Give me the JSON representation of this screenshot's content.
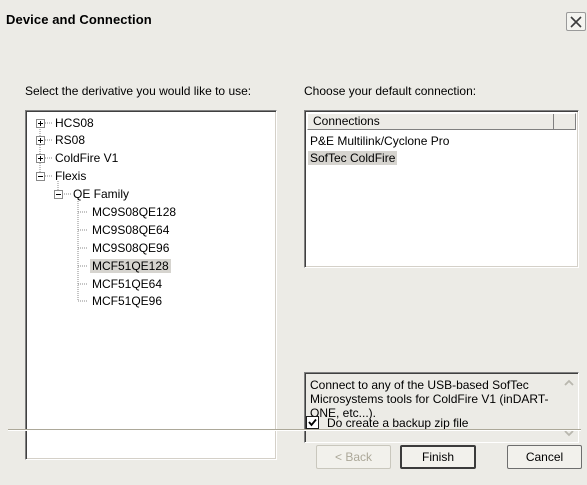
{
  "window": {
    "title": "Device and Connection"
  },
  "left_prompt": "Select the derivative you would like to use:",
  "right_prompt": "Choose your default connection:",
  "tree": {
    "items": [
      {
        "label": "HCS08",
        "expander": "+"
      },
      {
        "label": "RS08",
        "expander": "+"
      },
      {
        "label": "ColdFire V1",
        "expander": "+"
      },
      {
        "label": "Flexis",
        "expander": "-"
      },
      {
        "label": "QE Family",
        "expander": "-"
      },
      {
        "label": "MC9S08QE128"
      },
      {
        "label": "MC9S08QE64"
      },
      {
        "label": "MC9S08QE96"
      },
      {
        "label": "MCF51QE128",
        "selected": true
      },
      {
        "label": "MCF51QE64"
      },
      {
        "label": "MCF51QE96"
      }
    ]
  },
  "connections": {
    "header": "Connections",
    "items": [
      {
        "label": "P&E Multilink/Cyclone Pro"
      },
      {
        "label": "SofTec ColdFire",
        "selected": true
      }
    ]
  },
  "description": "Connect to any of the USB-based SofTec Microsystems tools for ColdFire V1 (inDART-ONE, etc...).",
  "backup_checkbox": {
    "label": "Do create a backup zip file",
    "checked": true
  },
  "buttons": {
    "back": "< Back",
    "finish": "Finish",
    "cancel": "Cancel"
  },
  "colors": {
    "selection": "#d6d4cf",
    "dialog_bg": "#ecebe6"
  }
}
